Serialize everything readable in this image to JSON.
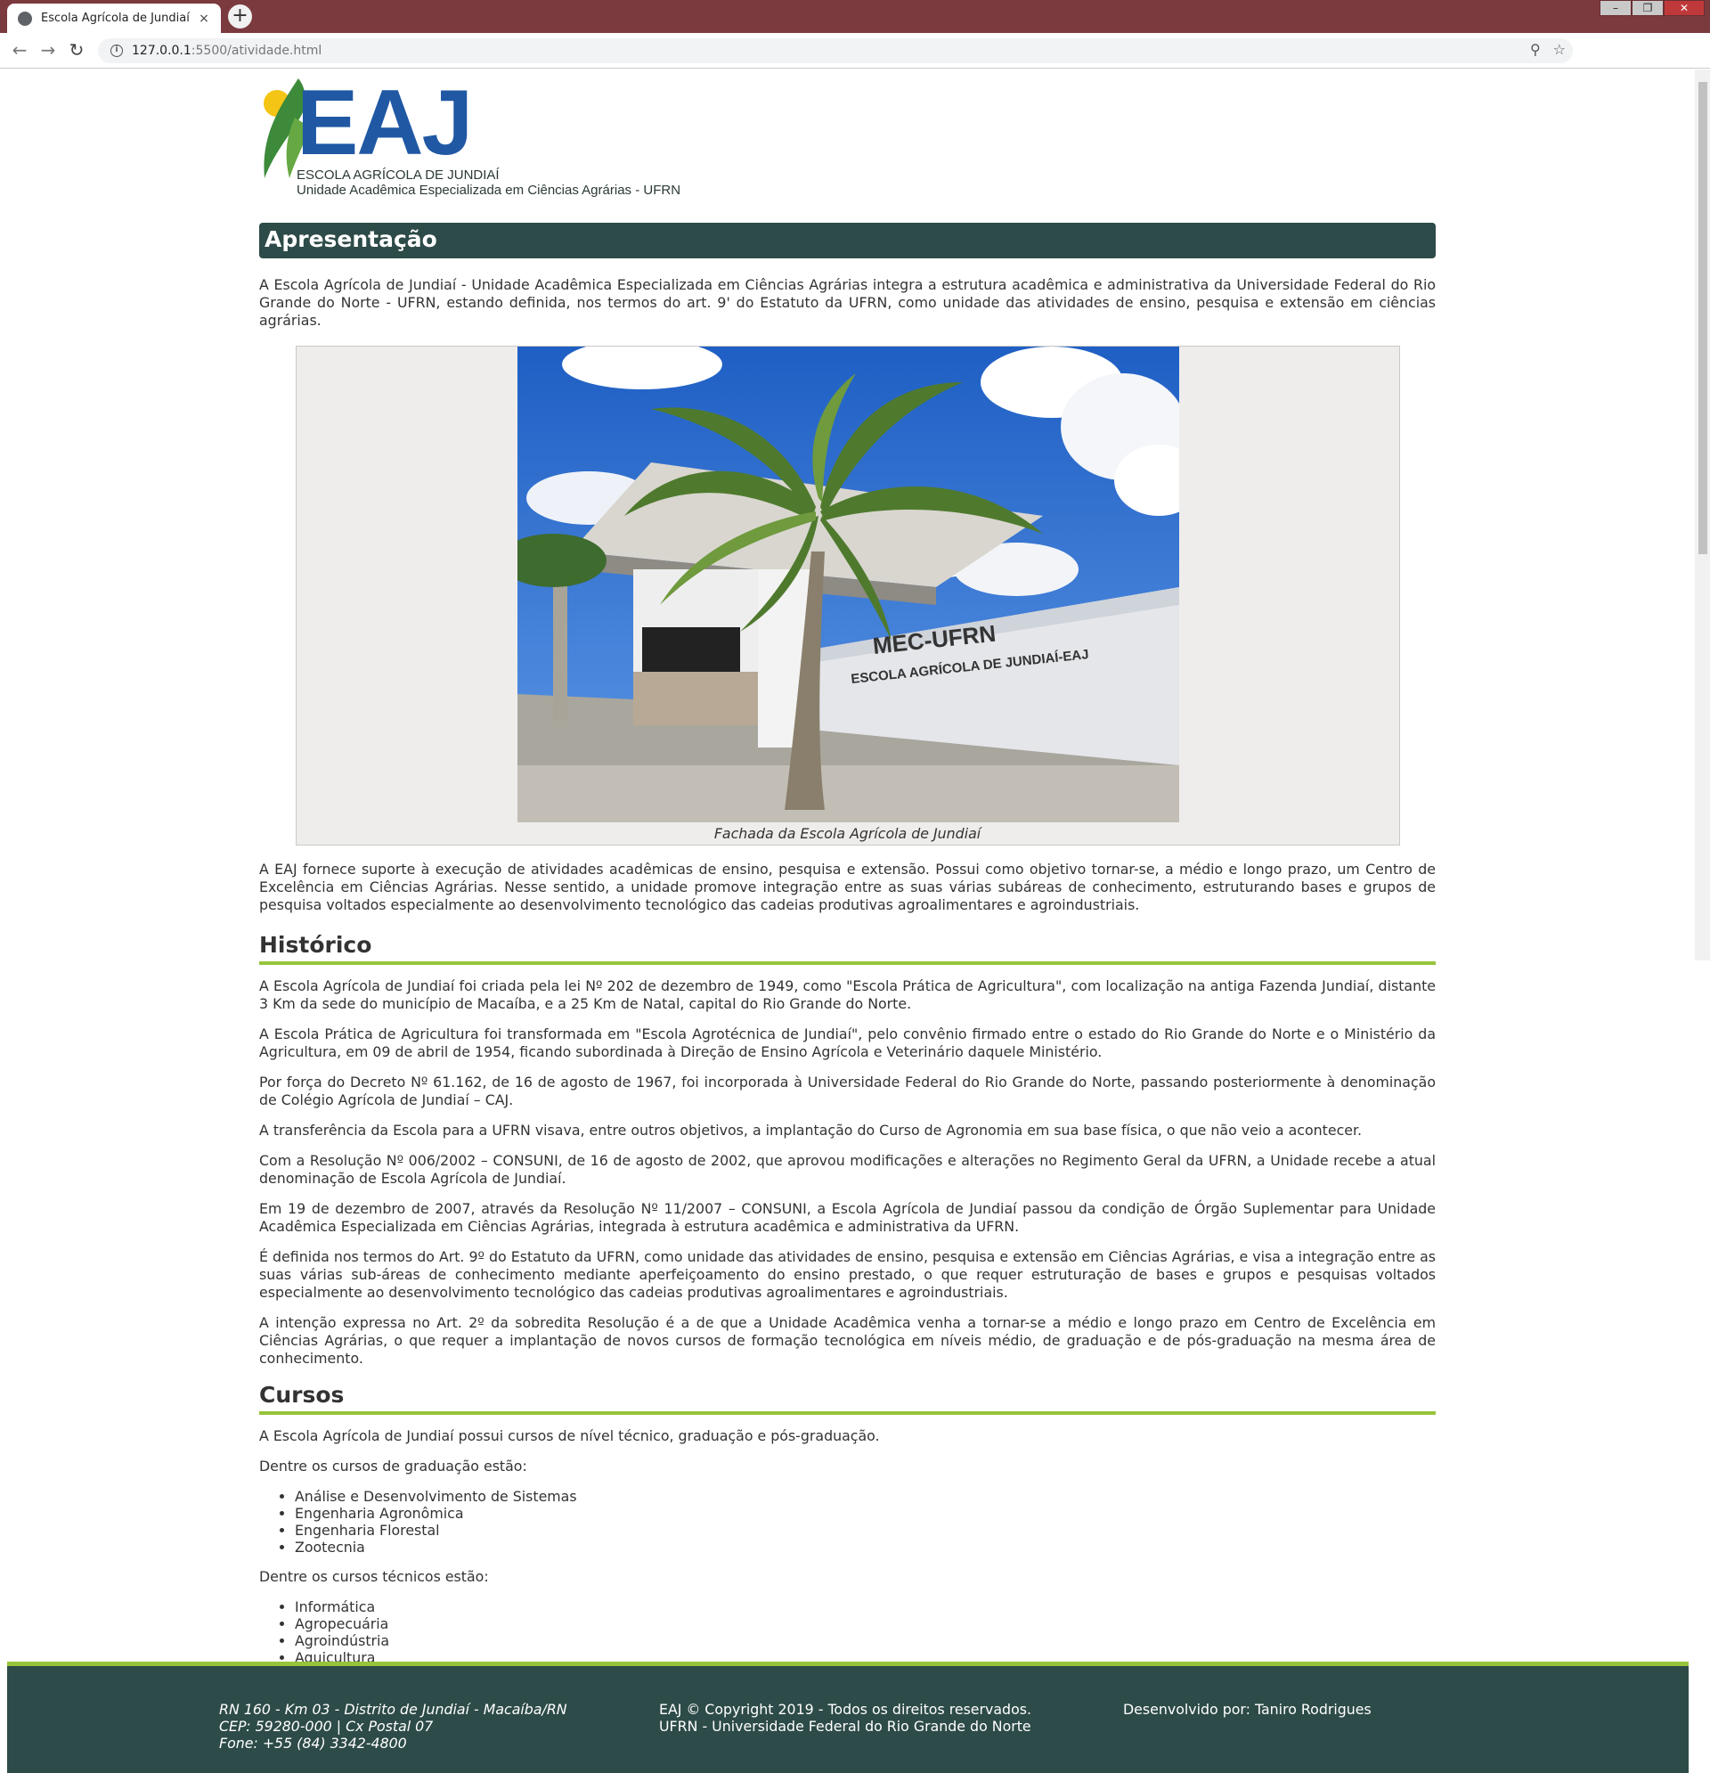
{
  "browser": {
    "tab_title": "Escola Agrícola de Jundiaí",
    "tab_close": "×",
    "new_tab": "+",
    "url_host": "127.0.0.1",
    "url_rest": ":5500/atividade.html",
    "win_minimize": "–",
    "win_restore": "❐",
    "win_close": "✕"
  },
  "logo": {
    "letters": "EAJ",
    "line1": "ESCOLA AGRÍCOLA DE JUNDIAÍ",
    "line2": "Unidade Acadêmica Especializada em Ciências Agrárias - UFRN",
    "colors": {
      "blue": "#2058a4",
      "green": "#3c8a3a",
      "sun": "#f4c514"
    }
  },
  "apresentacao": {
    "title": "Apresentação",
    "intro": "A Escola Agrícola de Jundiaí - Unidade Acadêmica Especializada em Ciências Agrárias integra a estrutura acadêmica e administrativa da Universidade Federal do Rio Grande do Norte - UFRN, estando definida, nos termos do art. 9' do Estatuto da UFRN, como unidade das atividades de ensino, pesquisa e extensão em ciências agrárias.",
    "photo_sign_line1": "MEC-UFRN",
    "photo_sign_line2": "ESCOLA AGRÍCOLA DE JUNDIAÍ-EAJ",
    "caption": "Fachada da Escola Agrícola de Jundiaí",
    "paragraph2": "A EAJ fornece suporte à execução de atividades acadêmicas de ensino, pesquisa e extensão. Possui como objetivo tornar-se, a médio e longo prazo, um Centro de Excelência em Ciências Agrárias. Nesse sentido, a unidade promove integração entre as suas várias subáreas de conhecimento, estruturando bases e grupos de pesquisa voltados especialmente ao desenvolvimento tecnológico das cadeias produtivas agroalimentares e agroindustriais."
  },
  "historico": {
    "title": "Histórico",
    "paragraphs": [
      "A Escola Agrícola de Jundiaí foi criada pela lei Nº 202 de dezembro de 1949, como \"Escola Prática de Agricultura\", com localização na antiga Fazenda Jundiaí, distante 3 Km da sede do município de Macaíba, e a 25 Km de Natal, capital do Rio Grande do Norte.",
      "A Escola Prática de Agricultura foi transformada em \"Escola Agrotécnica de Jundiaí\", pelo convênio firmado entre o estado do Rio Grande do Norte e o Ministério da Agricultura, em 09 de abril de 1954, ficando subordinada à Direção de Ensino Agrícola e Veterinário daquele Ministério.",
      "Por força do Decreto Nº 61.162, de 16 de agosto de 1967, foi incorporada à Universidade Federal do Rio Grande do Norte, passando posteriormente à denominação de Colégio Agrícola de Jundiaí – CAJ.",
      "A transferência da Escola para a UFRN visava, entre outros objetivos, a implantação do Curso de Agronomia em sua base física, o que não veio a acontecer.",
      "Com a Resolução Nº 006/2002 – CONSUNI, de 16 de agosto de 2002, que aprovou modificações e alterações no Regimento Geral da UFRN, a Unidade recebe a atual denominação de Escola Agrícola de Jundiaí.",
      "Em 19 de dezembro de 2007, através da Resolução Nº 11/2007 – CONSUNI, a Escola Agrícola de Jundiaí passou da condição de Órgão Suplementar para Unidade Acadêmica Especializada em Ciências Agrárias, integrada à estrutura acadêmica e administrativa da UFRN.",
      "É definida nos termos do Art. 9º do Estatuto da UFRN, como unidade das atividades de ensino, pesquisa e extensão em Ciências Agrárias, e visa a integração entre as suas várias sub-áreas de conhecimento mediante aperfeiçoamento do ensino prestado, o que requer estruturação de bases e grupos e pesquisas voltados especialmente ao desenvolvimento tecnológico das cadeias produtivas agroalimentares e agroindustriais.",
      "A intenção expressa no Art. 2º da sobredita Resolução é a de que a Unidade Acadêmica venha a tornar-se a médio e longo prazo em Centro de Excelência em Ciências Agrárias, o que requer a implantação de novos cursos de formação tecnológica em níveis médio, de graduação e de pós-graduação na mesma área de conhecimento."
    ]
  },
  "cursos": {
    "title": "Cursos",
    "intro": "A Escola Agrícola de Jundiaí possui cursos de nível técnico, graduação e pós-graduação.",
    "graduacao_label": "Dentre os cursos de graduação estão:",
    "graduacao": [
      "Análise e Desenvolvimento de Sistemas",
      "Engenharia Agronômica",
      "Engenharia Florestal",
      "Zootecnia"
    ],
    "tecnicos_label": "Dentre os cursos técnicos estão:",
    "tecnicos": [
      "Informática",
      "Agropecuária",
      "Agroindústria",
      "Aquicultura"
    ]
  },
  "footer": {
    "address1": "RN 160 - Km 03 - Distrito de Jundiaí - Macaíba/RN",
    "address2": "CEP: 59280-000 | Cx Postal 07",
    "address3": "Fone: +55 (84) 3342-4800",
    "copyright1": "EAJ © Copyright 2019 - Todos os direitos reservados.",
    "copyright2": "UFRN - Universidade Federal do Rio Grande do Norte",
    "dev": "Desenvolvido por: Taniro Rodrigues"
  },
  "colors": {
    "header_bg": "#2d4b48",
    "accent_green": "#97c43b",
    "browser_frame": "#7b3a3e"
  }
}
